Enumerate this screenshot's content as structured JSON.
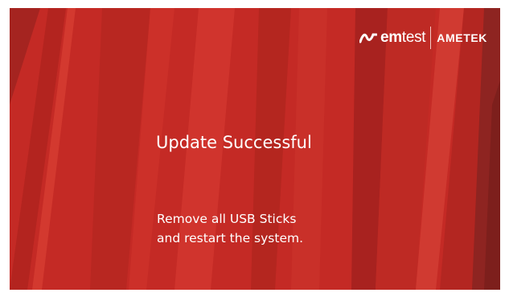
{
  "brand": {
    "logo_em": "em",
    "logo_test": "test",
    "logo_company": "AMETEK"
  },
  "status": {
    "title": "Update Successful",
    "message_line1": "Remove all USB Sticks",
    "message_line2": "and restart the system."
  },
  "colors": {
    "background": "#c42a25",
    "stripe_dark": "#8e2421",
    "stripe_mid": "#a8221f",
    "stripe_light": "#d23a32",
    "text": "#ffffff"
  }
}
